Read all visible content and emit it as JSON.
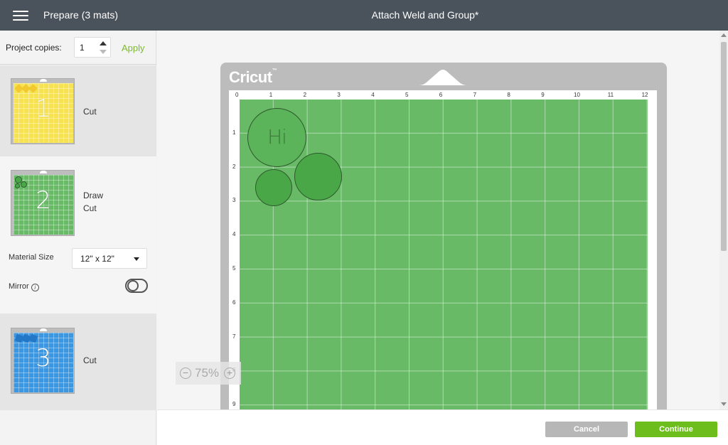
{
  "header": {
    "prepare_label": "Prepare (3 mats)",
    "project_title": "Attach Weld and Group*"
  },
  "sidebar": {
    "copies_label": "Project copies:",
    "copies_value": "1",
    "apply_label": "Apply",
    "mats": [
      {
        "number": "1",
        "color": "#f7e253",
        "lines": [
          "Cut"
        ]
      },
      {
        "number": "2",
        "color": "#69ba67",
        "lines": [
          "Draw",
          "Cut"
        ]
      },
      {
        "number": "3",
        "color": "#3d97e0",
        "lines": [
          "Cut"
        ]
      }
    ],
    "material_size_label": "Material Size",
    "material_size_value": "12\" x 12\"",
    "mirror_label": "Mirror",
    "info_glyph": "i"
  },
  "canvas": {
    "brand": "Cricut",
    "trademark": "™",
    "ruler_top": [
      "0",
      "1",
      "2",
      "3",
      "4",
      "5",
      "6",
      "7",
      "8",
      "9",
      "10",
      "11",
      "12"
    ],
    "ruler_left": [
      "1",
      "2",
      "3",
      "4",
      "5",
      "6",
      "7",
      "8",
      "9"
    ],
    "mat_color": "#69ba67",
    "shape_text": "Hi",
    "zoom": {
      "value": "75%",
      "minus": "−",
      "plus": "+"
    }
  },
  "footer": {
    "cancel_label": "Cancel",
    "continue_label": "Continue"
  }
}
